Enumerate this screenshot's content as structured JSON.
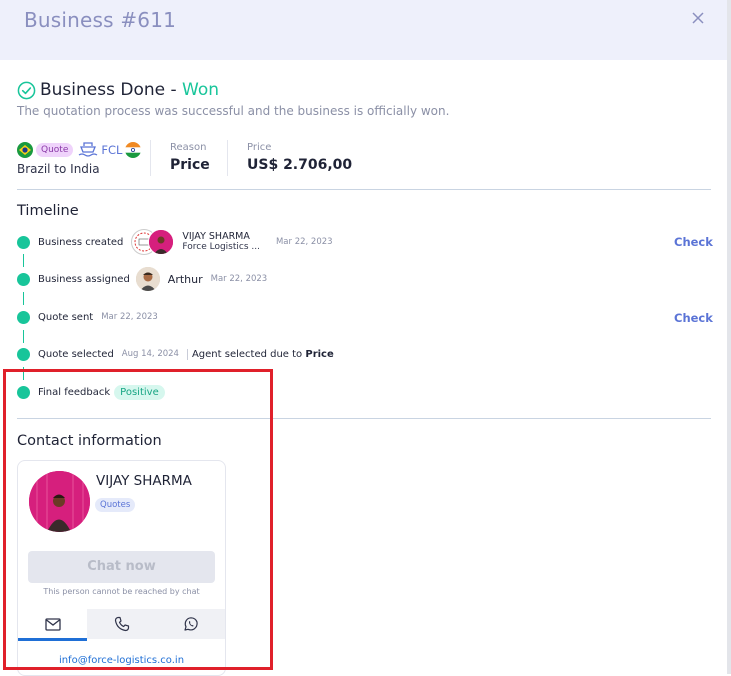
{
  "header": {
    "title": "Business #611"
  },
  "status": {
    "prefix": "Business Done - ",
    "outcome": "Won",
    "description": "The quotation process was successful and the business is officially won."
  },
  "summary": {
    "quote_badge": "Quote",
    "mode": "FCL",
    "route": "Brazil to India",
    "reason_label": "Reason",
    "reason_value": "Price",
    "price_label": "Price",
    "price_value": "US$ 2.706,00"
  },
  "timeline": {
    "title": "Timeline",
    "events": [
      {
        "label": "Business created",
        "person_name": "VIJAY SHARMA",
        "person_company": "Force Logistics ...",
        "date": "Mar 22, 2023",
        "action": "Check"
      },
      {
        "label": "Business assigned",
        "person_name": "Arthur",
        "date": "Mar 22, 2023"
      },
      {
        "label": "Quote sent",
        "date": "Mar 22, 2023",
        "action": "Check"
      },
      {
        "label": "Quote selected",
        "date": "Aug 14, 2024",
        "note_prefix": "Agent selected due to ",
        "note_value": "Price"
      },
      {
        "label": "Final feedback",
        "badge": "Positive"
      }
    ]
  },
  "contact": {
    "title": "Contact information",
    "name": "VIJAY SHARMA",
    "badge": "Quotes",
    "chat_button": "Chat now",
    "chat_note": "This person cannot be reached by chat",
    "email": "info@force-logistics.co.in"
  },
  "icons": {
    "status": "check-circle-icon",
    "close": "close-icon",
    "ship": "ship-icon",
    "email_tab": "mail-icon",
    "phone_tab": "phone-icon",
    "whatsapp_tab": "whatsapp-icon"
  },
  "colors": {
    "accent_green": "#18c59a",
    "link_blue": "#5b74d6",
    "highlight_red": "#e0202a"
  }
}
